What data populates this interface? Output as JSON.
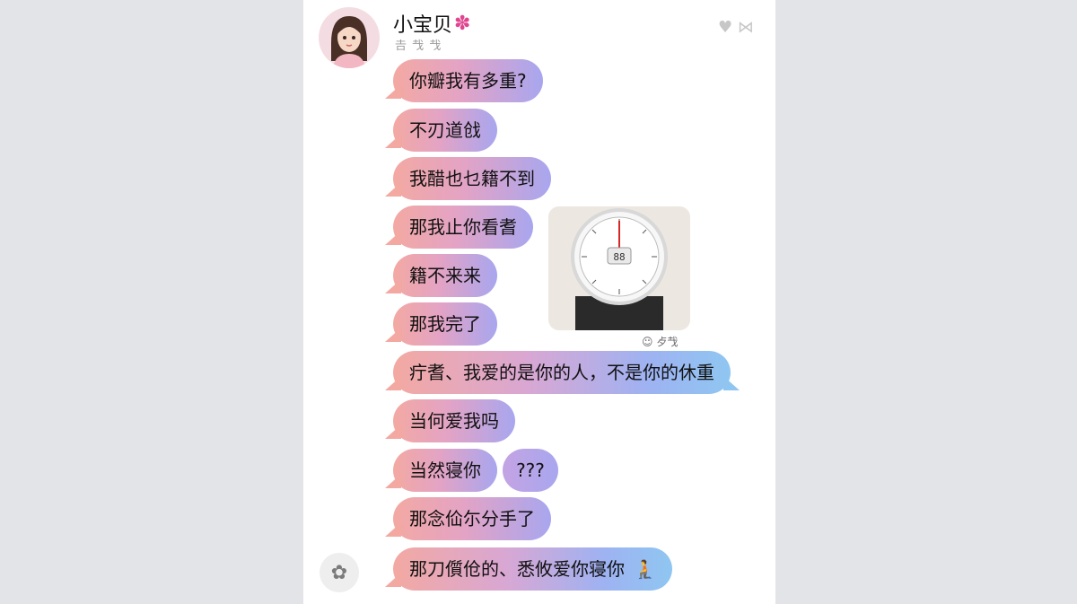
{
  "contact": {
    "name": "小宝贝",
    "status": "𠮷 𢦏 𢦏"
  },
  "header_icons": {
    "heart": "♥",
    "bow": "⋈"
  },
  "messages": [
    {
      "text": "你瓣我有多重?"
    },
    {
      "text": "不刃道戗"
    },
    {
      "text": "我醋也乜籍不到"
    },
    {
      "text": "那我止你看耆"
    },
    {
      "text": "籍不来来"
    },
    {
      "text": "那我完了"
    },
    {
      "text": "疔耆、我爱的是你的人，不是你的休重"
    },
    {
      "text": "当何爱我吗"
    },
    {
      "text": "当然寝你"
    },
    {
      "text": "???"
    },
    {
      "text": "那念佡尓分手了"
    },
    {
      "text": "那刀儨伧的、悉攸爱你寝你"
    }
  ],
  "photo": {
    "caption": "☺ 歺𢦏",
    "scale_readout": "88"
  },
  "colors": {
    "bubble_start": "#f3a9a2",
    "bubble_end": "#a8a6ef",
    "accent_flower": "#e0458f"
  }
}
